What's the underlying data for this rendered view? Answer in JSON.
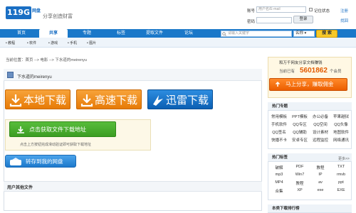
{
  "header": {
    "logo": "119G",
    "logo_sub": "网盘",
    "slogan": "分享创造财富",
    "account_label": "账号",
    "account_placeholder": "用户名/E-mail",
    "password_label": "密码",
    "remember_label": "记住状态",
    "login_label": "登录",
    "register_label": "注册",
    "forgot_label": "找回"
  },
  "nav": {
    "items": [
      "首页",
      "共享",
      "专题",
      "标签",
      "提取文件",
      "论坛"
    ],
    "active": "共享",
    "search_placeholder": "请输入关键字",
    "search_type": "名称",
    "search_button": "搜 索"
  },
  "subnav": [
    "教程",
    "软件",
    "游戏",
    "手机",
    "图片"
  ],
  "breadcrumb": "当前位置：首页 --> 电影 --> 下水道的meirenyu",
  "doc": {
    "title": "下水道的meirenyu",
    "dl_local": "本地下载",
    "dl_fast": "高速下载",
    "dl_xunlei": "迅雷下载",
    "get_address": "点击获取文件下载地址",
    "hint": "点击上方按钮完成滑动验证即可获取下载地址",
    "save_to_cloud": "转存到我的网盘",
    "other_files": "用户其他文件"
  },
  "promo": {
    "title": "和万千网友分享文档赚钱",
    "count_label": "当前已有",
    "count": "5601862",
    "count_unit": "个会员",
    "button": "马上分享，赚取佣金"
  },
  "hot_topics": {
    "title": "热门专题",
    "items": [
      "常用模板",
      "PPT模板",
      "办公必备",
      "苹果越狱",
      "手机软件",
      "QQ专区",
      "QQ空间",
      "QQ头像",
      "QQ签名",
      "QQ辅助",
      "设计素材",
      "地图软件",
      "快播不卡",
      "安卓专区",
      "远程监控",
      "网络通讯"
    ]
  },
  "hot_tags": {
    "title": "热门标签",
    "more": "更多>>",
    "items": [
      "破解",
      "PDF",
      "教程",
      "TXT",
      "mp3",
      "Win7",
      "IP",
      "rmvb",
      "MP4",
      "教程",
      "av",
      "ppt",
      "合集",
      "XP",
      "exe",
      "EXE"
    ]
  },
  "bottom": {
    "title": "本类下载排行榜"
  }
}
